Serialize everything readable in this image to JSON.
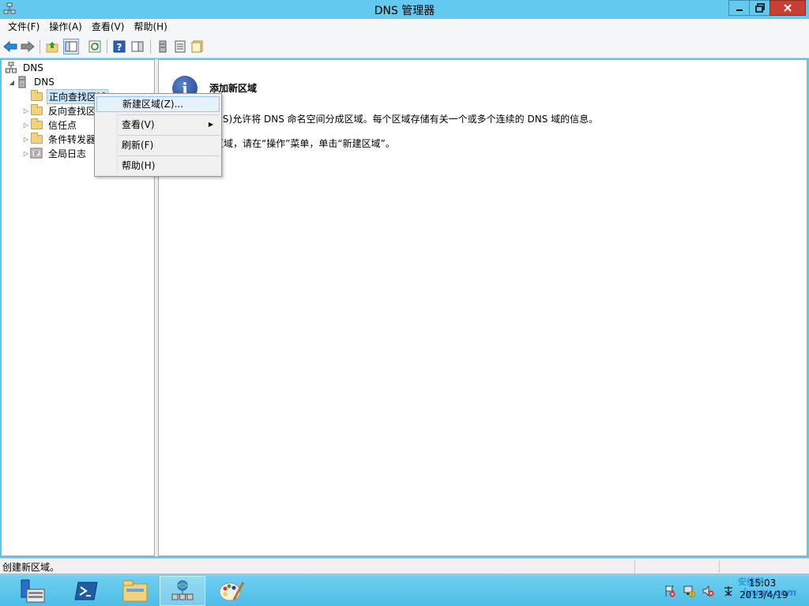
{
  "window": {
    "title": "DNS 管理器"
  },
  "menubar": {
    "items": [
      "文件(F)",
      "操作(A)",
      "查看(V)",
      "帮助(H)"
    ]
  },
  "tree": {
    "root": "DNS",
    "server": "DNS",
    "children": [
      "正向查找区域",
      "反向查找区",
      "信任点",
      "条件转发器",
      "全局日志"
    ]
  },
  "context_menu": {
    "new_zone": "新建区域(Z)...",
    "view": "查看(V)",
    "refresh": "刷新(F)",
    "help": "帮助(H)"
  },
  "info": {
    "title": "添加新区域",
    "line1": "(DNS)允许将 DNS 命名空间分成区域。每个区域存储有关一个或多个连续的 DNS 域的信息。",
    "line2": "新区域，请在“操作”菜单，单击“新建区域”。"
  },
  "statusbar": {
    "text": "创建新区域。"
  },
  "taskbar": {
    "time": "15:03",
    "date": "2013/4/19",
    "watermark_top": "安维网",
    "watermark_bottom": "iyunv.com"
  },
  "icons": {
    "app": "dns-server-icon",
    "back": "back-arrow-icon",
    "forward": "forward-arrow-icon",
    "info": "info-icon"
  },
  "colors": {
    "titlebar": "#63c9ee",
    "close": "#c74033",
    "taskbar": "#5bc8ec",
    "selection": "#cce8ff"
  }
}
